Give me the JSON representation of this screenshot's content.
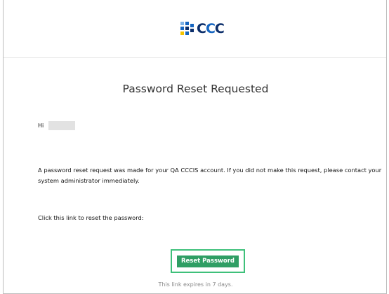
{
  "header": {
    "logo_text": "CCC"
  },
  "title": "Password Reset Requested",
  "greeting": {
    "salutation": "Hi"
  },
  "body": {
    "paragraph": "A password reset request was made for your QA CCCIS account. If you did not make this request, please contact your system administrator immediately.",
    "link_intro": "Click this link to reset the password:"
  },
  "button": {
    "label": "Reset Password"
  },
  "footer": {
    "expiry_note": "This link expires in 7 days."
  },
  "colors": {
    "brand_blue": "#1565c0",
    "brand_yellow": "#f4c400",
    "brand_dark": "#0b2e6b",
    "button_green": "#2f9e64",
    "button_border": "#3ec07a"
  },
  "icons": {
    "logo": "ccc-logo-icon",
    "redaction": "redacted-name-block"
  }
}
